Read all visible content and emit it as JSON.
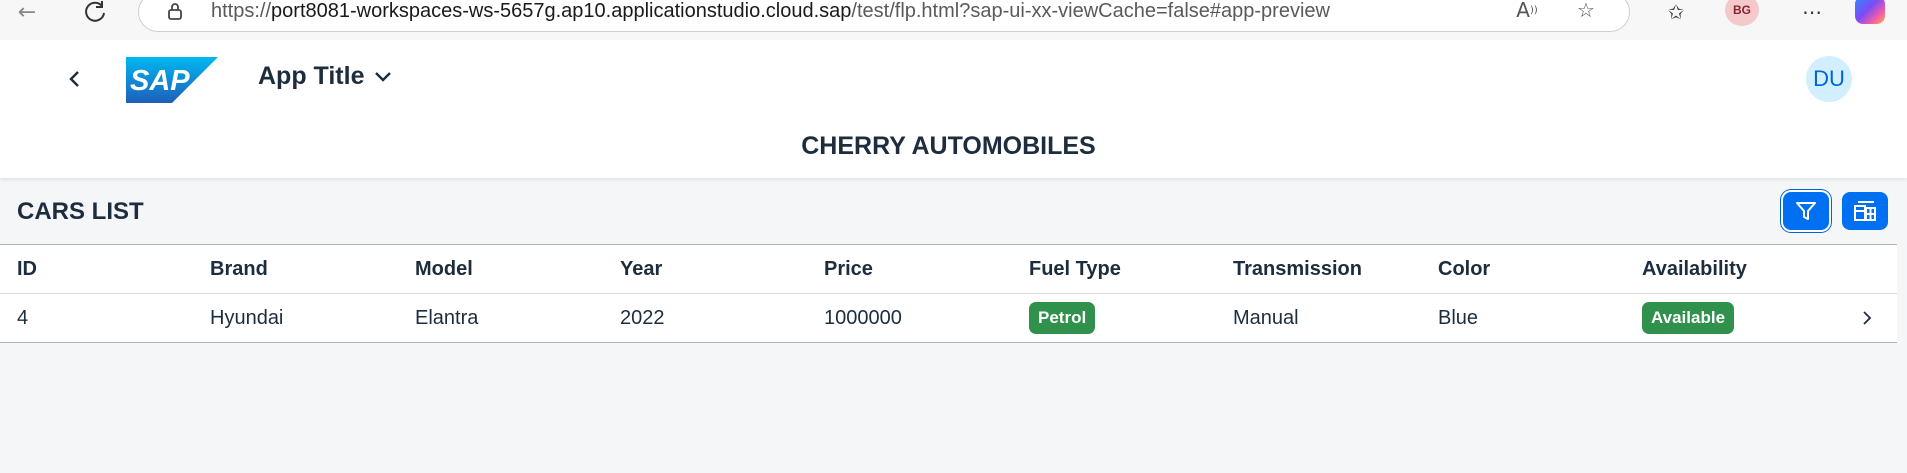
{
  "browser": {
    "url_prefix": "https://",
    "url_host": "port8081-workspaces-ws-5657g.ap10.applicationstudio.cloud.sap",
    "url_path": "/test/flp.html?sap-ui-xx-viewCache=false#app-preview",
    "profile_initials": "BG",
    "icons": [
      "back-arrow-icon",
      "refresh-icon",
      "lock-icon",
      "read-aloud-icon",
      "favorite-star-icon",
      "favorites-list-icon",
      "more-icon",
      "copilot-icon"
    ]
  },
  "shell": {
    "logo_text": "SAP",
    "app_title": "App Title",
    "user_initials": "DU",
    "colors": {
      "accent": "#0070f2",
      "avatar_bg": "#d1efff",
      "avatar_text": "#0064d9"
    }
  },
  "page": {
    "title": "CHERRY AUTOMOBILES"
  },
  "table": {
    "heading": "CARS LIST",
    "toolbar": [
      "filter-icon",
      "table-settings-icon"
    ],
    "columns": [
      "ID",
      "Brand",
      "Model",
      "Year",
      "Price",
      "Fuel Type",
      "Transmission",
      "Color",
      "Availability"
    ],
    "rows": [
      {
        "id": "4",
        "brand": "Hyundai",
        "model": "Elantra",
        "year": "2022",
        "price": "1000000",
        "fuel_type": "Petrol",
        "transmission": "Manual",
        "color": "Blue",
        "availability": "Available"
      }
    ],
    "badge_color": "#30914c"
  }
}
